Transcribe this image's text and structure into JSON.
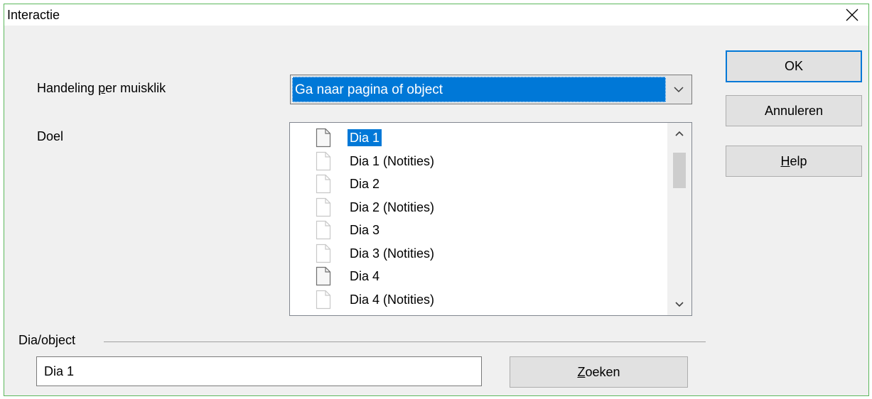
{
  "window": {
    "title": "Interactie"
  },
  "action": {
    "label_prefix": "Handeling ",
    "label_underlined": "p",
    "label_suffix": "er muisklik",
    "selected": "Ga naar pagina of object"
  },
  "target": {
    "label": "Doel",
    "items": [
      {
        "label": "Dia 1",
        "selected": true,
        "icon": "slide-icon"
      },
      {
        "label": "Dia 1 (Notities)",
        "selected": false,
        "icon": "notes-page-icon"
      },
      {
        "label": "Dia 2",
        "selected": false,
        "icon": "notes-page-icon"
      },
      {
        "label": "Dia 2 (Notities)",
        "selected": false,
        "icon": "notes-page-icon"
      },
      {
        "label": "Dia 3",
        "selected": false,
        "icon": "notes-page-icon"
      },
      {
        "label": "Dia 3 (Notities)",
        "selected": false,
        "icon": "notes-page-icon"
      },
      {
        "label": "Dia 4",
        "selected": false,
        "icon": "slide-icon"
      },
      {
        "label": "Dia 4 (Notities)",
        "selected": false,
        "icon": "notes-page-icon"
      }
    ]
  },
  "slide_object": {
    "section_label": "Dia/object",
    "value": "Dia 1",
    "search_underlined": "Z",
    "search_rest": "oeken"
  },
  "buttons": {
    "ok": "OK",
    "cancel": "Annuleren",
    "help_underlined": "H",
    "help_rest": "elp"
  }
}
